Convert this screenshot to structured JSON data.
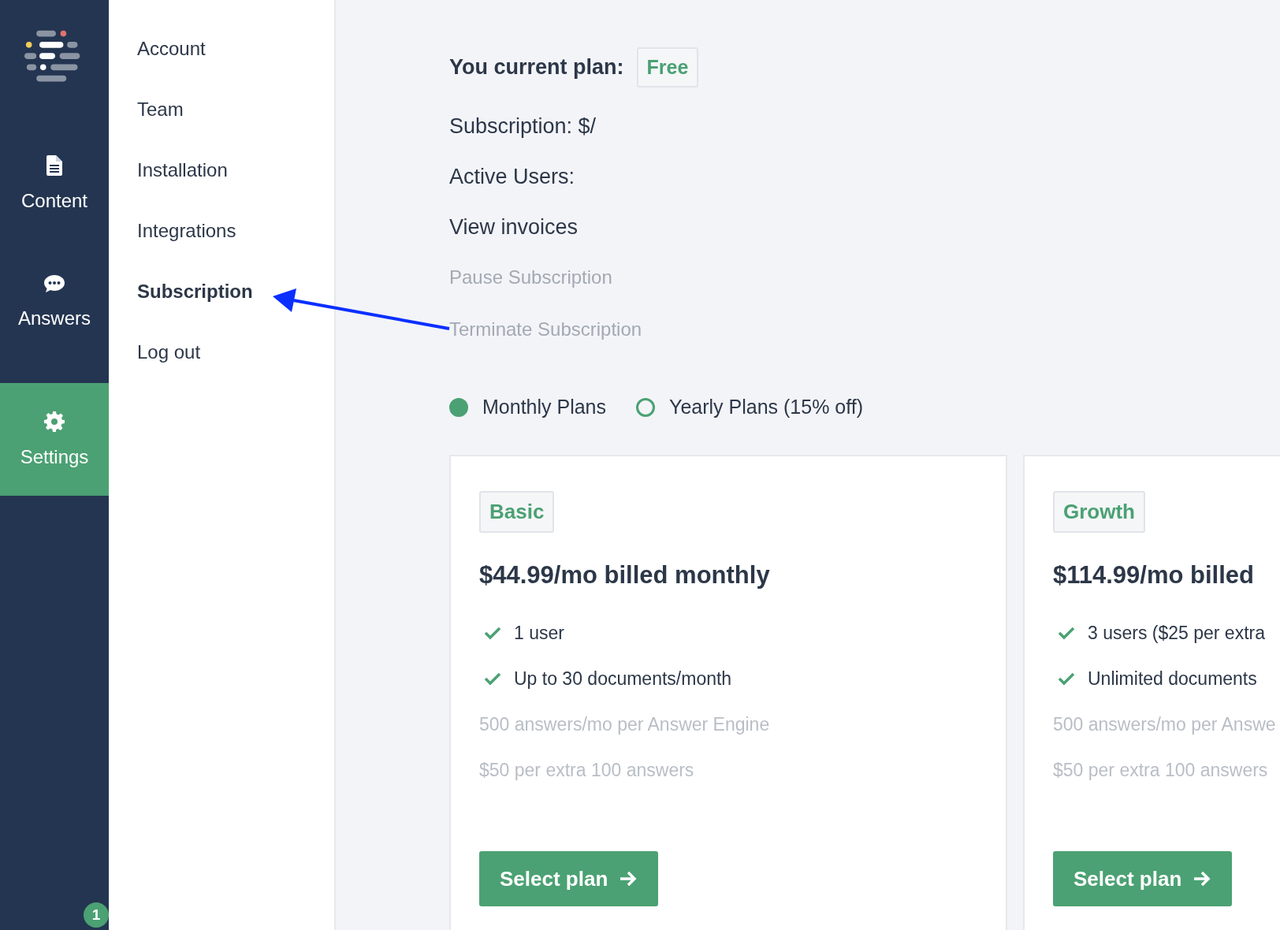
{
  "rail": {
    "items": [
      {
        "label": "Content",
        "selected": false
      },
      {
        "label": "Answers",
        "selected": false
      },
      {
        "label": "Settings",
        "selected": true
      }
    ],
    "notification_badge": "1"
  },
  "settings_menu": {
    "items": [
      {
        "label": "Account",
        "selected": false
      },
      {
        "label": "Team",
        "selected": false
      },
      {
        "label": "Installation",
        "selected": false
      },
      {
        "label": "Integrations",
        "selected": false
      },
      {
        "label": "Subscription",
        "selected": true
      },
      {
        "label": "Log out",
        "selected": false
      }
    ]
  },
  "subscription": {
    "current_plan_label": "You current plan:",
    "current_plan": "Free",
    "details": [
      "Subscription: $/",
      "Active Users:"
    ],
    "view_invoices": "View invoices",
    "actions": [
      "Pause Subscription",
      "Terminate Subscription"
    ],
    "billing_options": [
      {
        "label": "Monthly Plans",
        "selected": true
      },
      {
        "label": "Yearly Plans (15% off)",
        "selected": false
      }
    ],
    "plans": [
      {
        "name": "Basic",
        "price": "$44.99/mo billed monthly",
        "features": [
          {
            "text": "1 user",
            "included": true
          },
          {
            "text": "Up to 30 documents/month",
            "included": true
          },
          {
            "text": "500 answers/mo per Answer Engine",
            "included": false
          },
          {
            "text": "$50 per extra 100 answers",
            "included": false
          }
        ],
        "button": "Select plan"
      },
      {
        "name": "Growth",
        "price": "$114.99/mo billed",
        "features": [
          {
            "text": "3 users ($25 per extra",
            "included": true
          },
          {
            "text": "Unlimited documents",
            "included": true
          },
          {
            "text": "500 answers/mo per Answe",
            "included": false
          },
          {
            "text": "$50 per extra 100 answers",
            "included": false
          }
        ],
        "button": "Select plan"
      }
    ]
  },
  "annotation": {
    "kind": "arrow"
  }
}
